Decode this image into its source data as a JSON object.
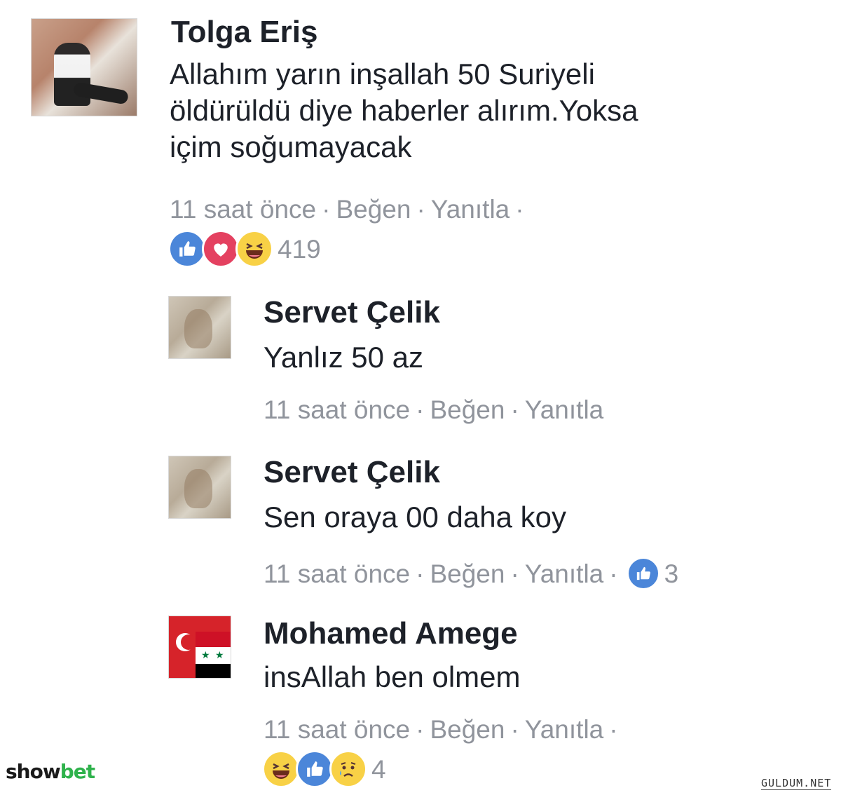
{
  "post": {
    "author": "Tolga Eriş",
    "text_lines": [
      "Allahım yarın inşallah 50 Suriyeli",
      "öldürüldü diye haberler alırım.Yoksa",
      "içim soğumayacak"
    ],
    "time": "11 saat önce",
    "like_label": "Beğen",
    "reply_label": "Yanıtla",
    "reactions": [
      "like-icon",
      "love-icon",
      "haha-icon"
    ],
    "reaction_count": "419"
  },
  "replies": [
    {
      "author": "Servet Çelik",
      "text": "Yanlız 50 az",
      "time": "11 saat önce",
      "like_label": "Beğen",
      "reply_label": "Yanıtla"
    },
    {
      "author": "Servet Çelik",
      "text": "Sen oraya 00 daha koy",
      "time": "11 saat önce",
      "like_label": "Beğen",
      "reply_label": "Yanıtla",
      "reactions": [
        "like-icon"
      ],
      "reaction_count": "3"
    },
    {
      "author": "Mohamed Amege",
      "text": "insAllah ben olmem",
      "time": "11 saat önce",
      "like_label": "Beğen",
      "reply_label": "Yanıtla",
      "reactions": [
        "haha-icon",
        "like-icon",
        "sad-icon"
      ],
      "reaction_count": "4"
    }
  ],
  "watermarks": {
    "left_prefix": "show",
    "left_accent": "bet",
    "right": "GULDUM.NET"
  },
  "colors": {
    "text": "#1d2129",
    "meta": "#90949c",
    "like": "#4b86d9",
    "love": "#e44160",
    "haha": "#f8d146",
    "watermark_accent": "#2fb24c"
  }
}
